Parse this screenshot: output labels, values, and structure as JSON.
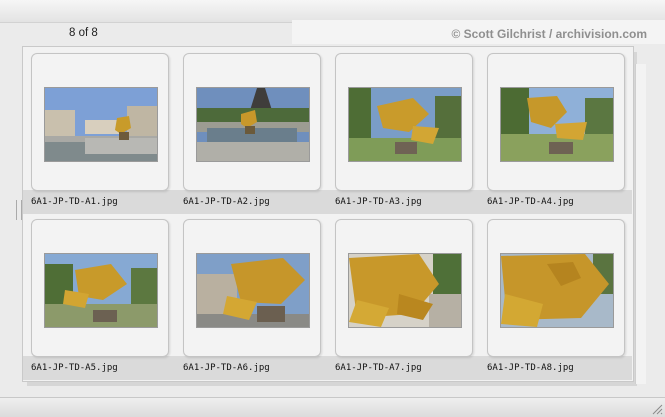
{
  "header": {
    "counter": "8 of 8",
    "copyright": "© Scott Gilchrist / archivision.com"
  },
  "slides": [
    {
      "filename": "6A1-JP-TD-A1.jpg"
    },
    {
      "filename": "6A1-JP-TD-A2.jpg"
    },
    {
      "filename": "6A1-JP-TD-A3.jpg"
    },
    {
      "filename": "6A1-JP-TD-A4.jpg"
    },
    {
      "filename": "6A1-JP-TD-A5.jpg"
    },
    {
      "filename": "6A1-JP-TD-A6.jpg"
    },
    {
      "filename": "6A1-JP-TD-A7.jpg"
    },
    {
      "filename": "6A1-JP-TD-A8.jpg"
    }
  ]
}
